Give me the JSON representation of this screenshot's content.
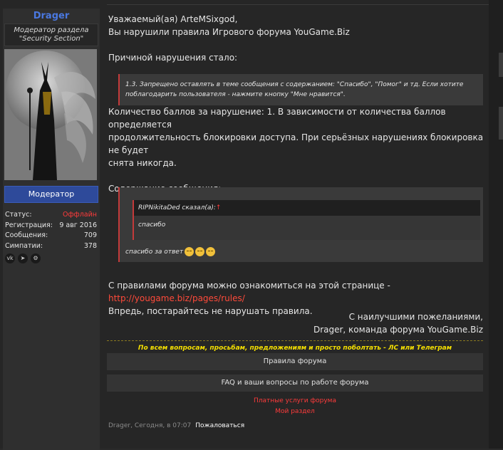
{
  "user": {
    "name": "Drager",
    "title_line1": "Модератор раздела",
    "title_line2": "\"Security Section\"",
    "role_button": "Модератор",
    "stats": [
      {
        "label": "Статус:",
        "value": "Оффлайн"
      },
      {
        "label": "Регистрация:",
        "value": "9 авг 2016"
      },
      {
        "label": "Сообщения:",
        "value": "709"
      },
      {
        "label": "Симпатии:",
        "value": "378"
      }
    ],
    "social_icons": [
      "vk-icon",
      "telegram-icon",
      "steam-icon"
    ]
  },
  "message": {
    "greeting": "Уважаемый(ая) ArteMSixgod,",
    "violation": "Вы нарушили правила Игрового форума YouGame.Biz",
    "reason_label": "Причиной нарушения стало:",
    "rule_text": "1.3. Запрещено оставлять в теме сообщения с содержанием: \"Спасибо\", \"Помог\" и тд. Если хотите поблагодарить пользователя - нажмите кнопку \"Мне нравится\".",
    "points_line1": "Количество баллов за нарушение: 1. В зависимости от количества баллов определяется",
    "points_line2": "продолжительность блокировки доступа. При серьёзных нарушениях блокировка не будет",
    "points_line3": "снята никогда.",
    "content_label": "Содержание сообщения:",
    "quote_author": "RIPNikitaDed сказал(а):",
    "quote_arrow": "↑",
    "quote_body": "спасибо",
    "reply_text": "спасибо за ответ",
    "rules_prefix": "С правилами форума можно ознакомиться на этой странице - ",
    "rules_link": "http://yougame.biz/pages/rules/",
    "advice": "Впредь, постарайтесь не нарушать правила.",
    "sig_line1": "С наилучшими пожеланиями,",
    "sig_line2": "Drager, команда форума YouGame.Biz"
  },
  "signature": {
    "note": "По всем вопросам, просьбам, предложениям и просто поболтать - ЛС или Телеграм",
    "btn_rules": "Правила форума",
    "btn_faq": "FAQ и ваши вопросы по работе форума",
    "link_paid": "Платные услуги форума",
    "link_section": "Мой раздел"
  },
  "footer": {
    "meta": "Drager, Сегодня, в 07:07",
    "report": "Пожаловаться"
  }
}
